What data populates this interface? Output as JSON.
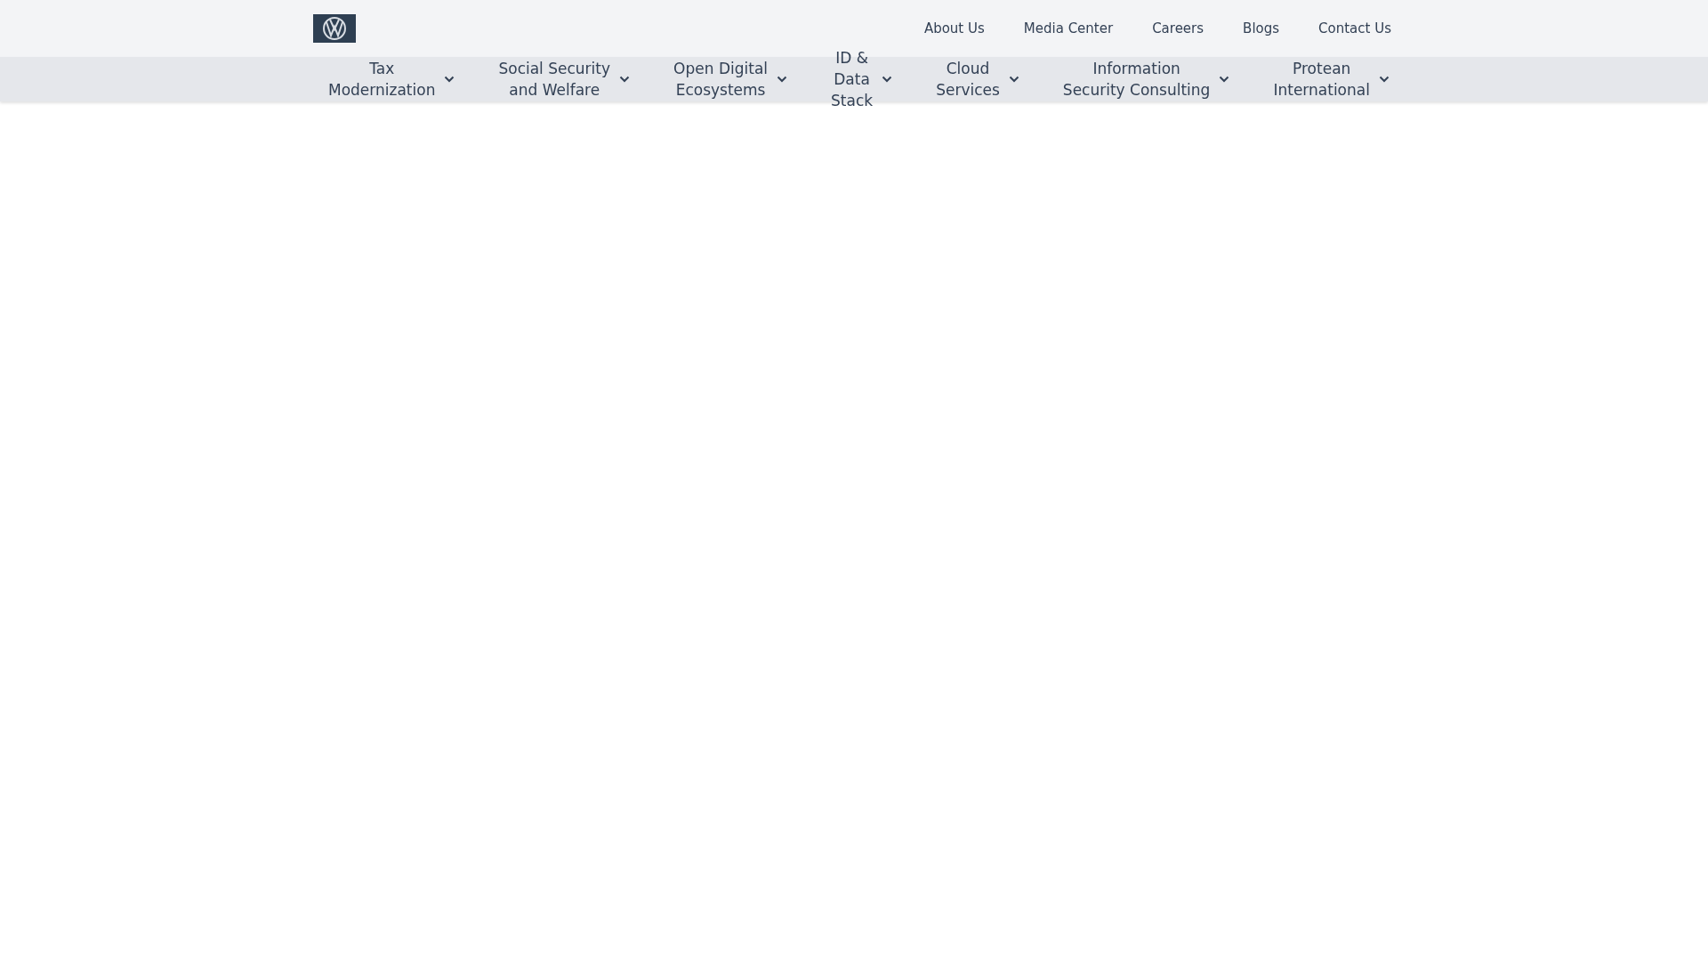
{
  "top_links": [
    "About Us",
    "Media Center",
    "Careers",
    "Blogs",
    "Contact Us"
  ],
  "nav": [
    {
      "lines": [
        "Tax",
        "Modernization"
      ]
    },
    {
      "lines": [
        "Social Security",
        "and Welfare"
      ]
    },
    {
      "lines": [
        "Open Digital",
        "Ecosystems"
      ]
    },
    {
      "lines": [
        "ID &",
        "Data",
        "Stack"
      ]
    },
    {
      "lines": [
        "Cloud",
        "Services"
      ]
    },
    {
      "lines": [
        "Information",
        "Security Consulting"
      ]
    },
    {
      "lines": [
        "Protean",
        "International"
      ]
    }
  ]
}
